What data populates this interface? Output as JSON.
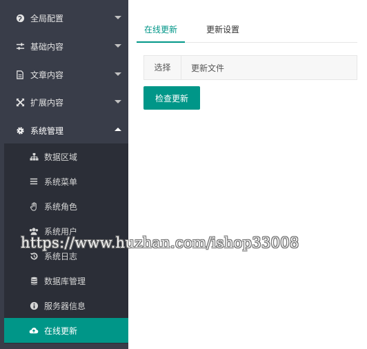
{
  "sidebar": {
    "items": [
      {
        "label": "全局配置",
        "icon": "globe-icon"
      },
      {
        "label": "基础内容",
        "icon": "sliders-icon"
      },
      {
        "label": "文章内容",
        "icon": "document-icon"
      },
      {
        "label": "扩展内容",
        "icon": "expand-icon"
      },
      {
        "label": "系统管理",
        "icon": "gear-icon"
      }
    ],
    "sub_items": [
      {
        "label": "数据区域",
        "icon": "sitemap-icon"
      },
      {
        "label": "系统菜单",
        "icon": "menu-icon"
      },
      {
        "label": "系统角色",
        "icon": "hand-icon"
      },
      {
        "label": "系统用户",
        "icon": "users-icon"
      },
      {
        "label": "系统日志",
        "icon": "history-icon"
      },
      {
        "label": "数据库管理",
        "icon": "database-icon"
      },
      {
        "label": "服务器信息",
        "icon": "info-icon"
      },
      {
        "label": "在线更新",
        "icon": "cloud-upload-icon"
      }
    ],
    "accent_color": "#009688"
  },
  "main": {
    "tabs": [
      {
        "label": "在线更新",
        "active": true
      },
      {
        "label": "更新设置",
        "active": false
      }
    ],
    "file": {
      "choose_label": "选择",
      "name_label": "更新文件"
    },
    "check_button_label": "检查更新"
  },
  "watermark": "https://www.huzhan.com/ishop33008"
}
